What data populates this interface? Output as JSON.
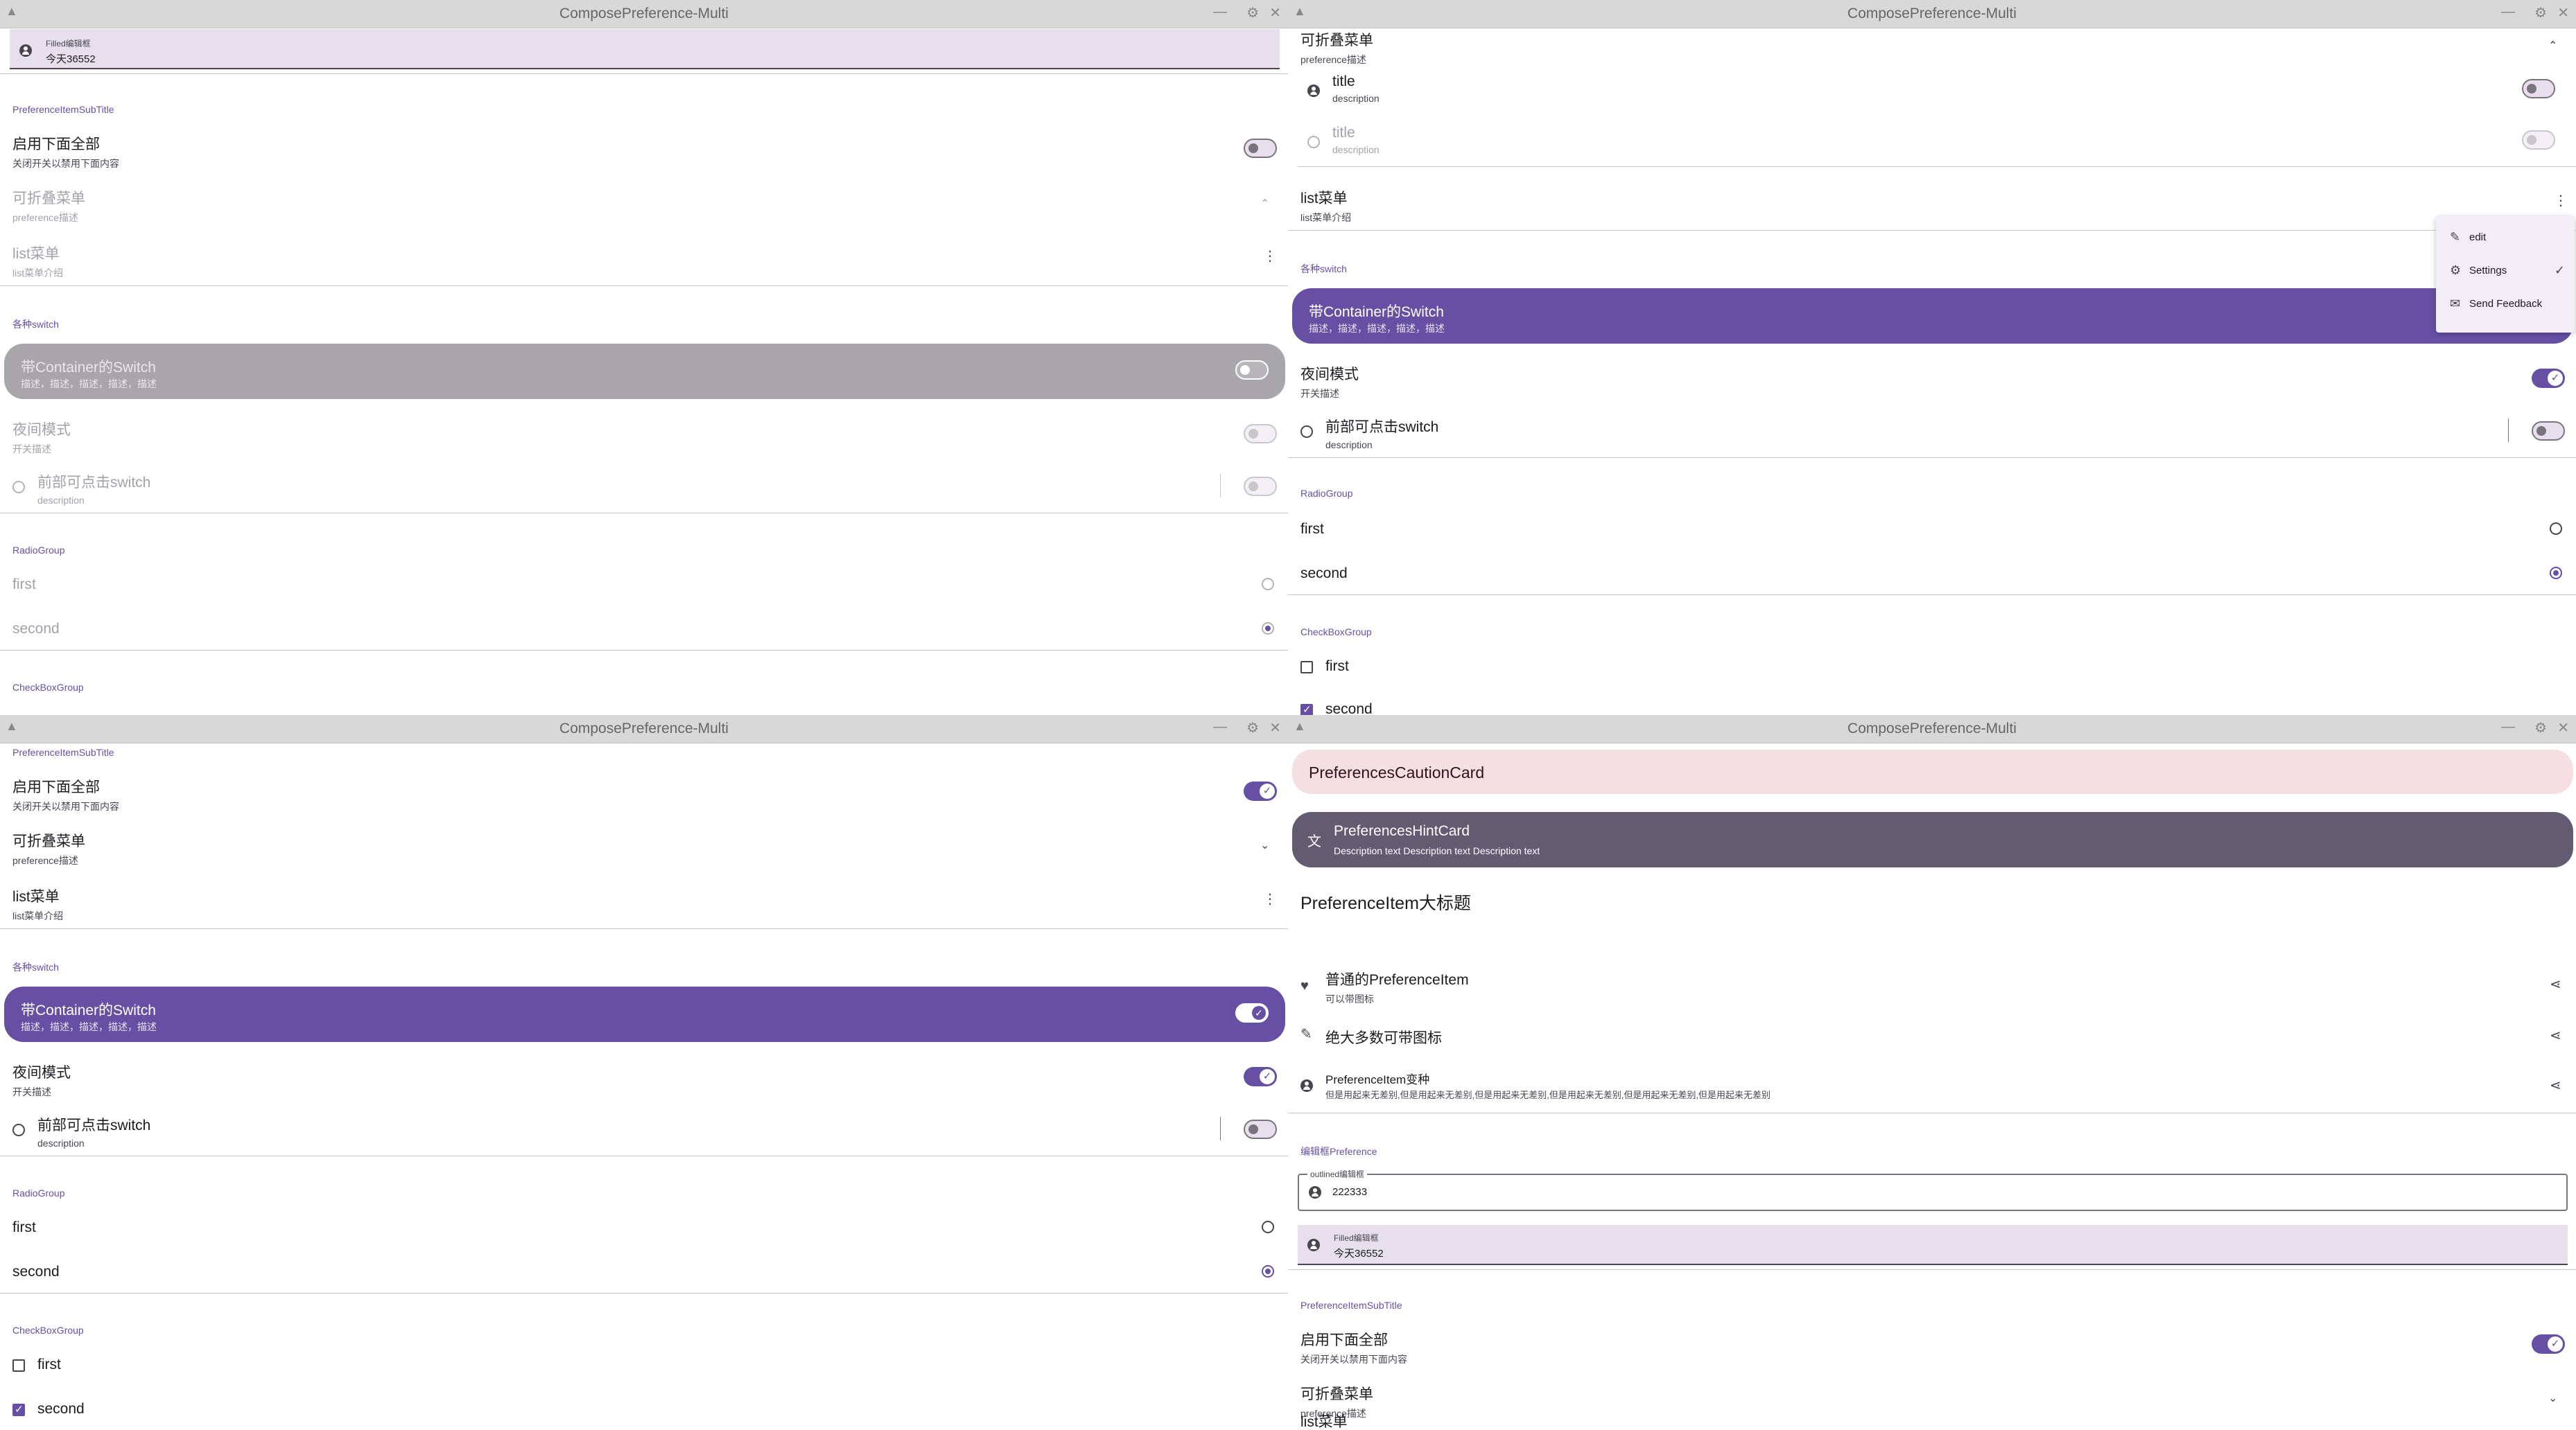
{
  "app": {
    "title": "ComposePreference-Multi"
  },
  "titlebar": {
    "minimize": "—",
    "maximize": "⚙",
    "close": "✕",
    "menu": "▲"
  },
  "common": {
    "filled_label": "Filled编辑框",
    "filled_value": "今天36552",
    "subtitle_header": "PreferenceItemSubTitle",
    "enable_all_title": "启用下面全部",
    "enable_all_desc": "关闭开关以禁用下面内容",
    "collapse_title": "可折叠菜单",
    "collapse_desc": "preference描述",
    "list_title": "list菜单",
    "list_desc": "list菜单介绍",
    "switch_header": "各种switch",
    "container_switch_title": "带Container的Switch",
    "container_switch_desc": "描述，描述，描述，描述，描述",
    "night_title": "夜间模式",
    "night_desc": "开关描述",
    "front_switch_title": "前部可点击switch",
    "front_switch_desc": "description",
    "radio_header": "RadioGroup",
    "radio_first": "first",
    "radio_second": "second",
    "checkbox_header": "CheckBoxGroup",
    "check_first": "first",
    "check_second": "second",
    "item_title": "title",
    "item_desc": "description"
  },
  "menu": {
    "items": [
      {
        "label": "edit",
        "icon": "edit-icon"
      },
      {
        "label": "Settings",
        "icon": "gear-icon",
        "checked": true
      },
      {
        "label": "Send Feedback",
        "icon": "mail-icon"
      }
    ]
  },
  "br": {
    "caution_card": "PreferencesCautionCard",
    "hint_title": "PreferencesHintCard",
    "hint_desc": "Description text Description text Description text",
    "big_title": "PreferenceItem大标题",
    "item1_title": "普通的PreferenceItem",
    "item1_desc": "可以带图标",
    "item2_title": "绝大多数可带图标",
    "item3_title": "PreferenceItem变种",
    "item3_desc": "但是用起来无差别,但是用起来无差别,但是用起来无差别,但是用起来无差别,但是用起来无差别,但是用起来无差别",
    "edit_header": "编辑框Preference",
    "outlined_label": "outlined编辑框",
    "outlined_value": "222333"
  },
  "colors": {
    "accent": "#6750a4",
    "hint_card": "#625b71",
    "caution_card": "#f6dfe2",
    "filled_bg": "#e7e0ec"
  }
}
